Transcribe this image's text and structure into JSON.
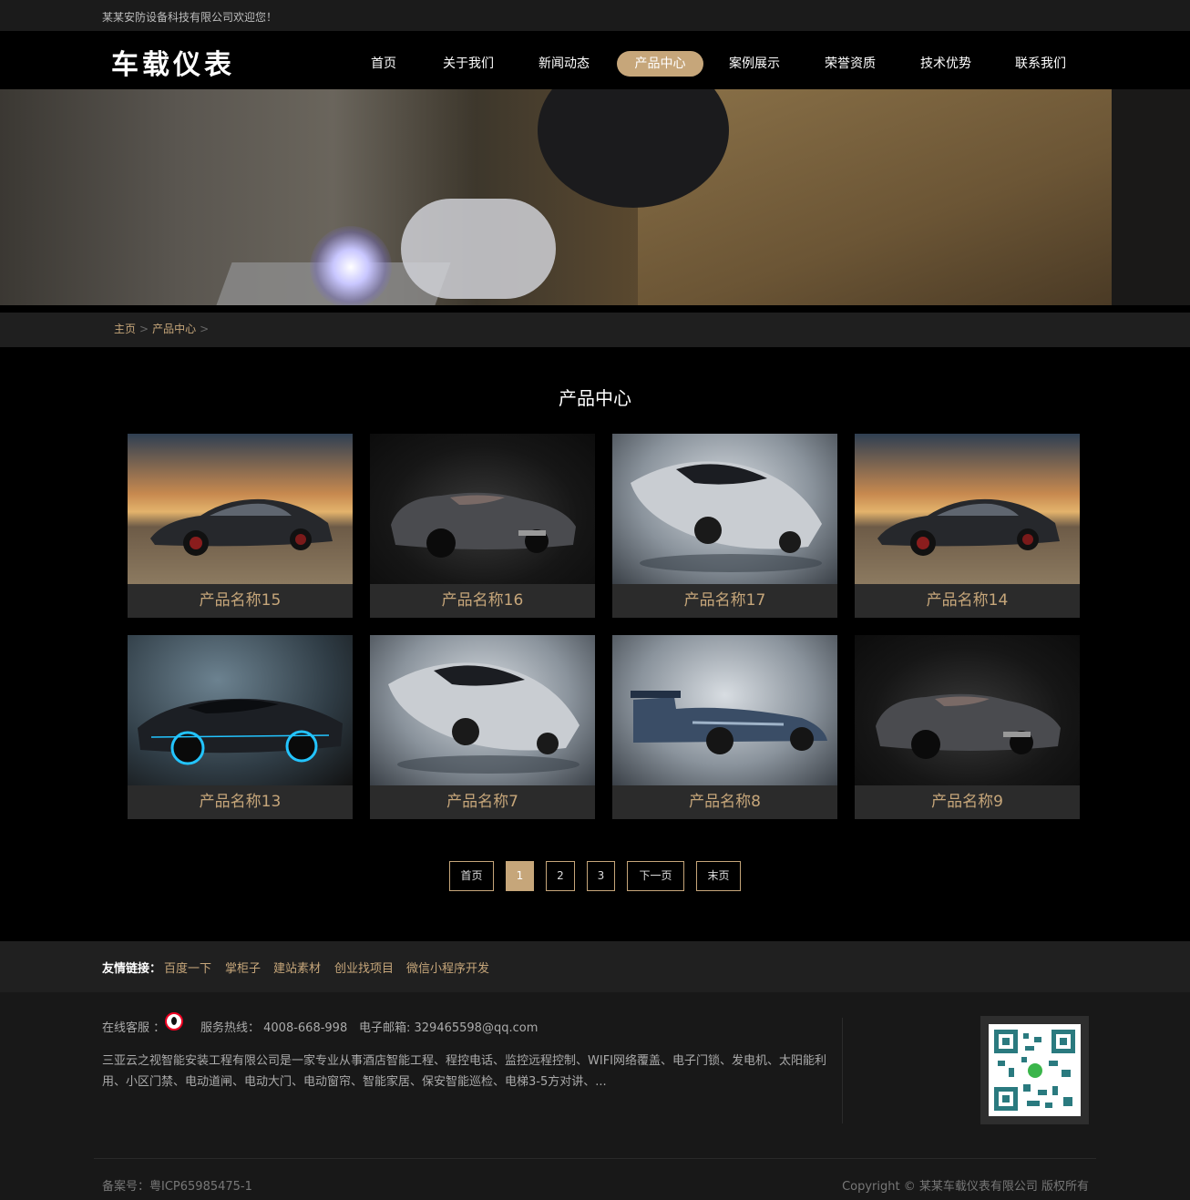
{
  "topbar": {
    "welcome": "某某安防设备科技有限公司欢迎您！"
  },
  "header": {
    "logo": "车载仪表",
    "nav": [
      {
        "label": "首页",
        "active": false
      },
      {
        "label": "关于我们",
        "active": false
      },
      {
        "label": "新闻动态",
        "active": false
      },
      {
        "label": "产品中心",
        "active": true
      },
      {
        "label": "案例展示",
        "active": false
      },
      {
        "label": "荣誉资质",
        "active": false
      },
      {
        "label": "技术优势",
        "active": false
      },
      {
        "label": "联系我们",
        "active": false
      }
    ]
  },
  "breadcrumb": {
    "home": "主页",
    "sep": ">",
    "current": "产品中心"
  },
  "section": {
    "title": "产品中心"
  },
  "products": [
    {
      "name": "产品名称15",
      "image": "sports-car-sunset"
    },
    {
      "name": "产品名称16",
      "image": "concept-roadster-dark"
    },
    {
      "name": "产品名称17",
      "image": "silver-supercar"
    },
    {
      "name": "产品名称14",
      "image": "sports-car-sunset"
    },
    {
      "name": "产品名称13",
      "image": "neon-supercar"
    },
    {
      "name": "产品名称7",
      "image": "silver-supercar"
    },
    {
      "name": "产品名称8",
      "image": "race-car"
    },
    {
      "name": "产品名称9",
      "image": "concept-roadster-dark"
    }
  ],
  "pager": {
    "first": "首页",
    "pages": [
      "1",
      "2",
      "3"
    ],
    "current": "1",
    "next": "下一页",
    "last": "末页"
  },
  "links": {
    "label": "友情链接：",
    "items": [
      "百度一下",
      "掌柜子",
      "建站素材",
      "创业找项目",
      "微信小程序开发"
    ]
  },
  "footer": {
    "service_label": "在线客服 ：",
    "hotline": "服务热线： 4008-668-998",
    "email": "电子邮箱: 329465598@qq.com",
    "description": "三亚云之视智能安装工程有限公司是一家专业从事酒店智能工程、程控电话、监控远程控制、WIFI网络覆盖、电子门锁、发电机、太阳能利用、小区门禁、电动道闸、电动大门、电动窗帘、智能家居、保安智能巡检、电梯3-5方对讲、...",
    "icp": "备案号：粤ICP65985475-1",
    "copyright": "Copyright © 某某车载仪表有限公司 版权所有"
  },
  "colors": {
    "accent": "#c6a67a",
    "background": "#000000",
    "bar": "#1f1f1f"
  }
}
